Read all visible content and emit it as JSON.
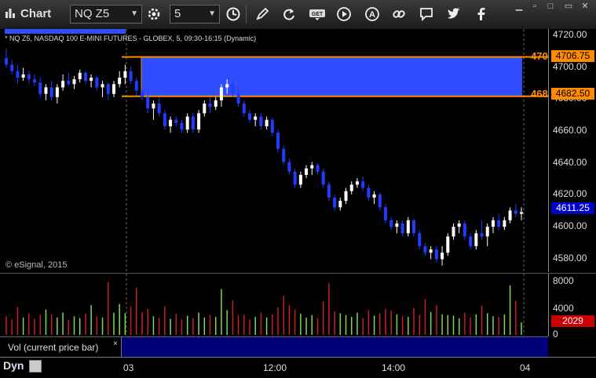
{
  "toolbar": {
    "title": "Chart",
    "symbol": "NQ Z5",
    "interval": "5",
    "colors": {
      "bg": "#1c1c1c",
      "accent": "#2f4cff"
    }
  },
  "chart": {
    "header": "* NQ Z5, NASDAQ 100 E-MINI FUTURES - GLOBEX, 5, 09:30-16:15 (Dynamic)",
    "watermark": "© eSignal, 2015",
    "price_ticks": [
      "4720.00",
      "4700.00",
      "4680.00",
      "4660.00",
      "4640.00",
      "4620.00",
      "4600.00",
      "4580.00"
    ],
    "upper_level": "4706.75",
    "lower_level": "4682.50",
    "upper_level_cut": "470",
    "lower_level_cut": "468",
    "current_price": "4611.25",
    "colors": {
      "zone": "#2f4cff",
      "level": "#ff8c00",
      "up": "#ffffff",
      "down": "#1f3cff",
      "current": "#0000cc"
    }
  },
  "volume": {
    "label": "Vol (current price bar)",
    "close": "×",
    "ticks": [
      "8000",
      "4000",
      "0"
    ],
    "current": "2029",
    "colors": {
      "up": "#7ed957",
      "down": "#c81e1e",
      "current_bg": "#cc0000"
    }
  },
  "time_axis": {
    "labels": [
      "03",
      "12:00",
      "14:00",
      "04"
    ],
    "dyn_label": "Dyn"
  },
  "chart_data": {
    "type": "candlestick",
    "ylim": [
      4574,
      4724
    ],
    "candles": [
      [
        4706,
        4712,
        4700,
        4702
      ],
      [
        4702,
        4705,
        4696,
        4698
      ],
      [
        4698,
        4702,
        4690,
        4694
      ],
      [
        4694,
        4700,
        4692,
        4696
      ],
      [
        4696,
        4698,
        4690,
        4693
      ],
      [
        4693,
        4696,
        4689,
        4691
      ],
      [
        4691,
        4694,
        4682,
        4684
      ],
      [
        4684,
        4690,
        4680,
        4688
      ],
      [
        4688,
        4692,
        4680,
        4682
      ],
      [
        4682,
        4690,
        4678,
        4688
      ],
      [
        4688,
        4696,
        4686,
        4692
      ],
      [
        4692,
        4697,
        4689,
        4690
      ],
      [
        4690,
        4695,
        4687,
        4693
      ],
      [
        4693,
        4699,
        4691,
        4697
      ],
      [
        4697,
        4698,
        4690,
        4692
      ],
      [
        4692,
        4696,
        4688,
        4694
      ],
      [
        4694,
        4695,
        4686,
        4688
      ],
      [
        4688,
        4692,
        4682,
        4690
      ],
      [
        4690,
        4691,
        4680,
        4684
      ],
      [
        4684,
        4692,
        4682,
        4690
      ],
      [
        4690,
        4698,
        4688,
        4694
      ],
      [
        4694,
        4702,
        4690,
        4698
      ],
      [
        4698,
        4701,
        4690,
        4692
      ],
      [
        4692,
        4694,
        4683,
        4686
      ],
      [
        4686,
        4690,
        4680,
        4682
      ],
      [
        4682,
        4684,
        4672,
        4675
      ],
      [
        4675,
        4680,
        4668,
        4678
      ],
      [
        4678,
        4682,
        4670,
        4672
      ],
      [
        4672,
        4674,
        4662,
        4664
      ],
      [
        4664,
        4670,
        4660,
        4668
      ],
      [
        4668,
        4670,
        4664,
        4666
      ],
      [
        4666,
        4668,
        4660,
        4662
      ],
      [
        4662,
        4672,
        4660,
        4670
      ],
      [
        4670,
        4672,
        4660,
        4662
      ],
      [
        4662,
        4674,
        4660,
        4672
      ],
      [
        4672,
        4680,
        4670,
        4678
      ],
      [
        4678,
        4682,
        4672,
        4676
      ],
      [
        4676,
        4682,
        4674,
        4680
      ],
      [
        4680,
        4690,
        4676,
        4688
      ],
      [
        4688,
        4693,
        4684,
        4690
      ],
      [
        4690,
        4692,
        4682,
        4684
      ],
      [
        4684,
        4688,
        4676,
        4678
      ],
      [
        4678,
        4680,
        4670,
        4672
      ],
      [
        4672,
        4674,
        4666,
        4668
      ],
      [
        4668,
        4672,
        4664,
        4670
      ],
      [
        4670,
        4672,
        4662,
        4664
      ],
      [
        4664,
        4670,
        4662,
        4668
      ],
      [
        4668,
        4669,
        4658,
        4660
      ],
      [
        4660,
        4662,
        4648,
        4650
      ],
      [
        4650,
        4652,
        4640,
        4642
      ],
      [
        4642,
        4644,
        4634,
        4636
      ],
      [
        4636,
        4638,
        4626,
        4628
      ],
      [
        4628,
        4636,
        4626,
        4634
      ],
      [
        4634,
        4640,
        4632,
        4638
      ],
      [
        4638,
        4642,
        4634,
        4640
      ],
      [
        4640,
        4641,
        4634,
        4636
      ],
      [
        4636,
        4638,
        4626,
        4628
      ],
      [
        4628,
        4630,
        4618,
        4620
      ],
      [
        4620,
        4622,
        4612,
        4614
      ],
      [
        4614,
        4620,
        4612,
        4618
      ],
      [
        4618,
        4626,
        4616,
        4624
      ],
      [
        4624,
        4630,
        4622,
        4628
      ],
      [
        4628,
        4632,
        4626,
        4630
      ],
      [
        4630,
        4633,
        4624,
        4626
      ],
      [
        4626,
        4628,
        4618,
        4620
      ],
      [
        4620,
        4624,
        4616,
        4622
      ],
      [
        4622,
        4623,
        4612,
        4614
      ],
      [
        4614,
        4616,
        4604,
        4606
      ],
      [
        4606,
        4608,
        4600,
        4602
      ],
      [
        4602,
        4606,
        4598,
        4604
      ],
      [
        4604,
        4606,
        4596,
        4598
      ],
      [
        4598,
        4608,
        4596,
        4606
      ],
      [
        4606,
        4607,
        4596,
        4598
      ],
      [
        4598,
        4600,
        4588,
        4590
      ],
      [
        4590,
        4592,
        4584,
        4586
      ],
      [
        4586,
        4590,
        4582,
        4588
      ],
      [
        4588,
        4590,
        4580,
        4582
      ],
      [
        4582,
        4590,
        4578,
        4586
      ],
      [
        4586,
        4598,
        4584,
        4596
      ],
      [
        4596,
        4604,
        4594,
        4602
      ],
      [
        4602,
        4606,
        4598,
        4604
      ],
      [
        4604,
        4606,
        4594,
        4596
      ],
      [
        4596,
        4598,
        4588,
        4590
      ],
      [
        4590,
        4600,
        4588,
        4598
      ],
      [
        4598,
        4606,
        4594,
        4596
      ],
      [
        4596,
        4604,
        4590,
        4602
      ],
      [
        4602,
        4608,
        4598,
        4606
      ],
      [
        4606,
        4610,
        4600,
        4602
      ],
      [
        4602,
        4608,
        4600,
        4606
      ],
      [
        4606,
        4614,
        4604,
        4612
      ],
      [
        4612,
        4616,
        4608,
        4610
      ],
      [
        4610,
        4614,
        4606,
        4611
      ]
    ],
    "volume_max": 9500,
    "volume": [
      3000,
      2500,
      4500,
      2800,
      3500,
      2600,
      3200,
      4100,
      3300,
      2800,
      3600,
      2400,
      3000,
      2700,
      3400,
      4800,
      3000,
      2800,
      8500,
      3600,
      5000,
      3500,
      4600,
      7600,
      3700,
      4200,
      3000,
      2800,
      4600,
      2600,
      3400,
      2500,
      3100,
      2700,
      3600,
      2800,
      3200,
      2900,
      7400,
      4000,
      5600,
      3100,
      3200,
      2500,
      2900,
      3600,
      2800,
      3300,
      4400,
      6300,
      4800,
      4100,
      3400,
      2800,
      3200,
      2700,
      5400,
      8400,
      3800,
      3500,
      3200,
      2900,
      3600,
      2700,
      4000,
      3100,
      3500,
      4200,
      3900,
      3300,
      3000,
      2900,
      4300,
      3200,
      5800,
      3700,
      4800,
      3300,
      3200,
      3100,
      2700,
      3600,
      2800,
      3300,
      4700,
      3500,
      3000,
      2900,
      3300,
      8000,
      5500,
      2029
    ]
  }
}
